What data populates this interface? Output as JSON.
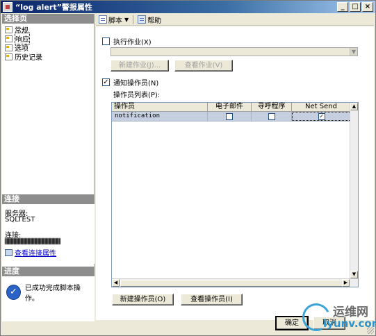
{
  "window": {
    "title": "“log alert”警报属性",
    "buttons": {
      "minimize": "_",
      "maximize": "□",
      "close": "×"
    }
  },
  "left_pane": {
    "select_page_header": "选择页",
    "pages": [
      {
        "label": "常规",
        "selected": false
      },
      {
        "label": "响应",
        "selected": true
      },
      {
        "label": "选项",
        "selected": false
      },
      {
        "label": "历史记录",
        "selected": false
      }
    ],
    "connection_header": "连接",
    "server_label": "服务器:",
    "server_value": "SQLTEST",
    "connection_label": "连接:",
    "view_connection_link": "查看连接属性",
    "progress_header": "进度",
    "progress_text": "已成功完成脚本操作。"
  },
  "toolbar": {
    "script_label": "脚本",
    "help_label": "帮助"
  },
  "response": {
    "execute_job_label": "执行作业(X)",
    "execute_job_checked": false,
    "job_combo_value": "",
    "new_job_button": "新建作业(J)...",
    "view_job_button": "查看作业(V)",
    "notify_operators_label": "通知操作员(N)",
    "notify_operators_checked": true,
    "operator_list_label": "操作员列表(P):",
    "grid": {
      "columns": [
        "操作员",
        "电子邮件",
        "寻呼程序",
        "Net Send"
      ],
      "rows": [
        {
          "operator": "notification",
          "email": false,
          "pager": false,
          "net_send": true
        }
      ]
    },
    "new_operator_button": "新建操作员(O)",
    "view_operator_button": "查看操作员(I)"
  },
  "footer": {
    "ok_button": "确定",
    "cancel_button": "取消"
  },
  "watermark": {
    "line1": "运维网",
    "line2": "iyunv.com"
  }
}
